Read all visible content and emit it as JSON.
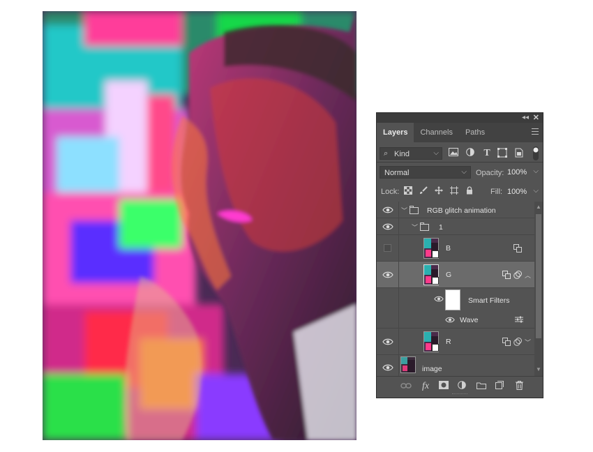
{
  "panel": {
    "tabs": [
      {
        "label": "Layers",
        "active": true
      },
      {
        "label": "Channels",
        "active": false
      },
      {
        "label": "Paths",
        "active": false
      }
    ],
    "filter": {
      "label": "Kind"
    },
    "blend_mode": "Normal",
    "opacity_label": "Opacity:",
    "opacity_value": "100%",
    "lock_label": "Lock:",
    "fill_label": "Fill:",
    "fill_value": "100%",
    "layers": [
      {
        "name": "RGB glitch animation",
        "type": "group",
        "visible": true
      },
      {
        "name": "1",
        "type": "group",
        "visible": true
      },
      {
        "name": "B",
        "type": "smart-object",
        "visible": false
      },
      {
        "name": "G",
        "type": "smart-object",
        "visible": true,
        "selected": true
      },
      {
        "name": "Smart Filters",
        "type": "smart-filters",
        "visible": true
      },
      {
        "name": "Wave",
        "type": "filter",
        "visible": true
      },
      {
        "name": "R",
        "type": "smart-object",
        "visible": true
      },
      {
        "name": "image",
        "type": "pixel",
        "visible": true
      }
    ]
  },
  "colors": {
    "panel_bg": "#535353",
    "tab_bar_bg": "#424242",
    "selected_row": "#6b6b6b",
    "canvas_bg": "#ffffff"
  }
}
